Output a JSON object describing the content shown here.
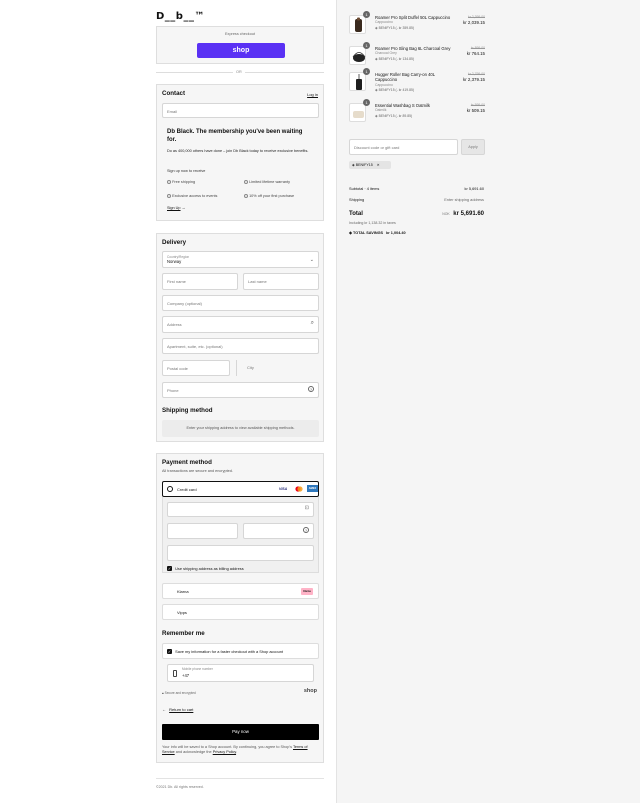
{
  "brand": {
    "logo": "D__b__™"
  },
  "express": {
    "label": "Express checkout",
    "shop_button": "shop",
    "or": "OR"
  },
  "contact": {
    "title": "Contact",
    "login": "Log in",
    "email_placeholder": "Email",
    "membership_title": "Db Black. The membership you've been waiting for.",
    "membership_desc": "Do as 400,000 others have done – join Db Black today to receive exclusive benefits.",
    "signup_prompt": "Sign up now to receive",
    "benefits": [
      "Free shipping",
      "Limited lifetime warranty",
      "Exclusive access to events",
      "10% off your first purchase"
    ],
    "signup_link": "Sign Up"
  },
  "delivery": {
    "title": "Delivery",
    "country_label": "Country/Region",
    "country_value": "Norway",
    "first_name": "First name",
    "last_name": "Last name",
    "company": "Company (optional)",
    "address": "Address",
    "apartment": "Apartment, suite, etc. (optional)",
    "postal": "Postal code",
    "city": "City",
    "phone": "Phone"
  },
  "shipping": {
    "title": "Shipping method",
    "notice": "Enter your shipping address to view available shipping methods."
  },
  "payment": {
    "title": "Payment method",
    "subtitle": "All transactions are secure and encrypted.",
    "credit_card": "Credit card",
    "cards": [
      "VISA",
      "MC",
      "AMEX"
    ],
    "billing_same": "Use shipping address as billing address",
    "klarna": "Klarna",
    "klarna_badge": "Klarna",
    "vipps": "Vipps"
  },
  "remember": {
    "title": "Remember me",
    "save_info": "Save my information for a faster checkout with a Shop account",
    "phone_label": "Mobile phone number",
    "phone_value": "+47",
    "secure": "Secure and encrypted",
    "shop": "shop"
  },
  "footer_actions": {
    "return": "Return to cart",
    "pay": "Pay now",
    "terms_pre": "Your info will be saved to a Shop account. By continuing, you agree to Shop's",
    "terms_link": "Terms of Service",
    "terms_mid": "and acknowledge the",
    "privacy_link": "Privacy Policy",
    "copyright": "©2021 Db. All rights reserved."
  },
  "cart": {
    "items": [
      {
        "qty": "1",
        "name": "Roamer Pro Split Duffel 50L Cappuccino",
        "variant": "Cappuccino",
        "discount": "BENIFY15 (- kr 359.85)",
        "old_price": "kr 2,399.00",
        "price": "kr 2,039.15"
      },
      {
        "qty": "1",
        "name": "Roamer Pro Sling Bag 6L Charcoal Grey",
        "variant": "Charcoal Grey",
        "discount": "BENIFY15 (- kr 134.85)",
        "old_price": "kr 899.00",
        "price": "kr 764.15"
      },
      {
        "qty": "1",
        "name": "Hugger Roller Bag Carry-on 40L Cappuccino",
        "variant": "Cappuccino",
        "discount": "BENIFY15 (- kr 419.85)",
        "old_price": "kr 2,799.00",
        "price": "kr 2,379.15"
      },
      {
        "qty": "1",
        "name": "Essential Washbag S Oatmilk",
        "variant": "Oatmilk",
        "discount": "BENIFY15 (- kr 89.85)",
        "old_price": "kr 599.00",
        "price": "kr 509.15"
      }
    ],
    "discount_placeholder": "Discount code or gift card",
    "apply": "Apply",
    "applied_code": "BENIFY15",
    "subtotal_label": "Subtotal · 4 items",
    "subtotal_value": "kr 5,691.60",
    "shipping_label": "Shipping",
    "shipping_value": "Enter shipping address",
    "total_label": "Total",
    "currency": "NOK",
    "total_value": "kr 5,691.60",
    "taxes": "Including kr 1,138.32 in taxes",
    "savings_label": "TOTAL SAVINGS",
    "savings_value": "kr 1,004.40"
  }
}
